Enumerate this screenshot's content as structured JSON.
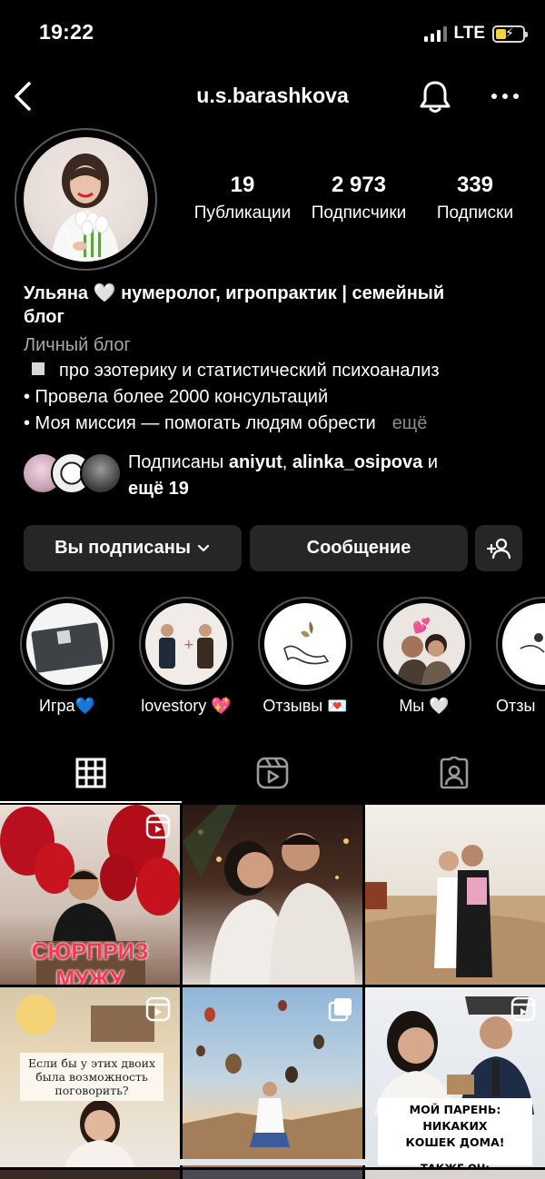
{
  "status_bar": {
    "time": "19:22",
    "network": "LTE",
    "battery_level": 0.4,
    "icons": [
      "signal-icon",
      "battery-charging-icon"
    ]
  },
  "header": {
    "username": "u.s.barashkova",
    "icons": [
      "back-chevron-icon",
      "bell-icon",
      "more-dots-icon"
    ]
  },
  "stats": [
    {
      "value": "19",
      "label": "Публикации"
    },
    {
      "value": "2 973",
      "label": "Подписчики"
    },
    {
      "value": "339",
      "label": "Подписки"
    }
  ],
  "bio": {
    "name_line1": "Ульяна 🤍 нумеролог, игропрактик | семейный",
    "name_line2": "блог",
    "category": "Личный блог",
    "line1": "про эзотерику и статистический психоанализ",
    "line2": "• Провела более 2000 консультаций",
    "line3": "• Моя миссия — помогать людям обрести",
    "more": "ещё"
  },
  "followed_by": {
    "prefix": "Подписаны ",
    "user1": "aniyut",
    "sep": ", ",
    "user2": "alinka_osipova",
    "suffix": " и",
    "more": "ещё 19"
  },
  "buttons": {
    "following": "Вы подписаны",
    "message": "Сообщение"
  },
  "highlights": [
    {
      "label": "Игра💙"
    },
    {
      "label": "lovestory 💖"
    },
    {
      "label": "Отзывы 💌"
    },
    {
      "label": "Мы 🤍"
    },
    {
      "label": "Отзы"
    }
  ],
  "tabs": [
    "grid-icon",
    "reels-icon",
    "tagged-icon"
  ],
  "posts": {
    "p1_text_line1": "СЮРПРИЗ",
    "p1_text_line2": "МУЖУ",
    "p4_text": "Если бы у этих двоих была возможность поговорить?",
    "p6_text_line1": "МОЙ ПАРЕНЬ: НИКАКИХ",
    "p6_text_line2": "КОШЕК ДОМА!",
    "p6_text_line3": "ТАКЖЕ ОН:"
  },
  "colors": {
    "background": "#000000",
    "button": "#262626",
    "muted": "#a8a8a8",
    "heart_blue": "#2f7bf6"
  }
}
